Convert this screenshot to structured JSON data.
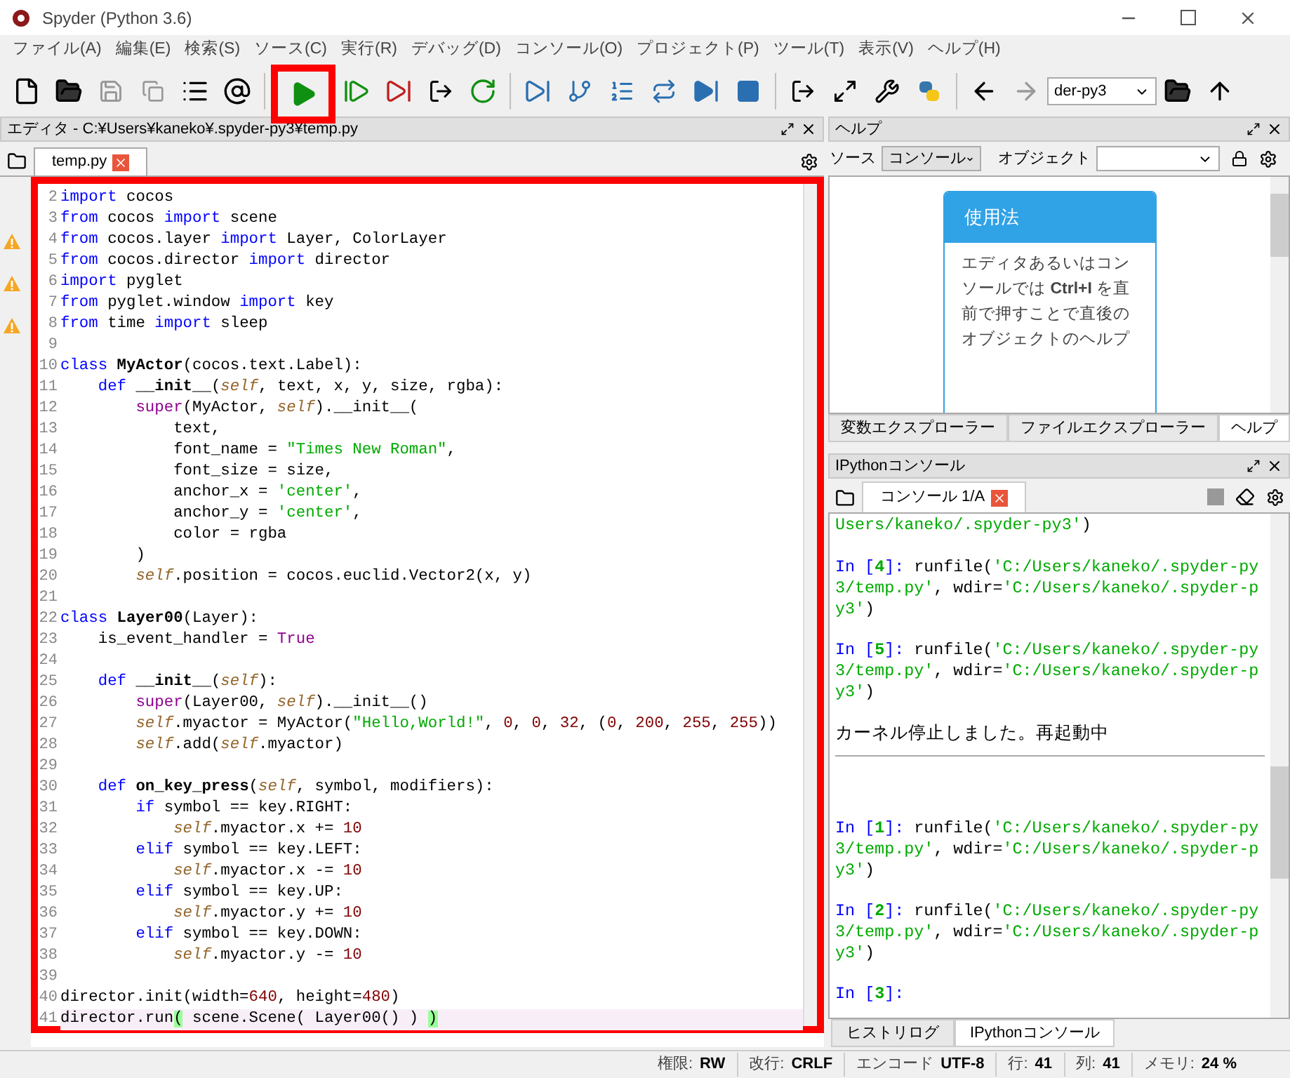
{
  "window": {
    "title": "Spyder (Python 3.6)"
  },
  "menu": [
    "ファイル(A)",
    "編集(E)",
    "検索(S)",
    "ソース(C)",
    "実行(R)",
    "デバッグ(D)",
    "コンソール(O)",
    "プロジェクト(P)",
    "ツール(T)",
    "表示(V)",
    "ヘルプ(H)"
  ],
  "toolbar": {
    "working_directory": "der-py3"
  },
  "editor": {
    "title": "エディタ - C:¥Users¥kaneko¥.spyder-py3¥temp.py",
    "tabs": [
      {
        "label": "temp.py",
        "selected": true
      }
    ],
    "lines": [
      {
        "number": "2",
        "warning": false,
        "current": false,
        "tokens": [
          {
            "kind": "kw",
            "text": "import"
          },
          {
            "kind": "plain",
            "text": " cocos"
          }
        ]
      },
      {
        "number": "3",
        "warning": false,
        "current": false,
        "tokens": [
          {
            "kind": "kw",
            "text": "from"
          },
          {
            "kind": "plain",
            "text": " cocos "
          },
          {
            "kind": "kw",
            "text": "import"
          },
          {
            "kind": "plain",
            "text": " scene"
          }
        ]
      },
      {
        "number": "4",
        "warning": true,
        "current": false,
        "tokens": [
          {
            "kind": "kw",
            "text": "from"
          },
          {
            "kind": "plain",
            "text": " cocos.layer "
          },
          {
            "kind": "kw",
            "text": "import"
          },
          {
            "kind": "plain",
            "text": " Layer, ColorLayer"
          }
        ]
      },
      {
        "number": "5",
        "warning": false,
        "current": false,
        "tokens": [
          {
            "kind": "kw",
            "text": "from"
          },
          {
            "kind": "plain",
            "text": " cocos.director "
          },
          {
            "kind": "kw",
            "text": "import"
          },
          {
            "kind": "plain",
            "text": " director"
          }
        ]
      },
      {
        "number": "6",
        "warning": true,
        "current": false,
        "tokens": [
          {
            "kind": "kw",
            "text": "import"
          },
          {
            "kind": "plain",
            "text": " pyglet"
          }
        ]
      },
      {
        "number": "7",
        "warning": false,
        "current": false,
        "tokens": [
          {
            "kind": "kw",
            "text": "from"
          },
          {
            "kind": "plain",
            "text": " pyglet.window "
          },
          {
            "kind": "kw",
            "text": "import"
          },
          {
            "kind": "plain",
            "text": " key"
          }
        ]
      },
      {
        "number": "8",
        "warning": true,
        "current": false,
        "tokens": [
          {
            "kind": "kw",
            "text": "from"
          },
          {
            "kind": "plain",
            "text": " time "
          },
          {
            "kind": "kw",
            "text": "import"
          },
          {
            "kind": "plain",
            "text": " sleep"
          }
        ]
      },
      {
        "number": "9",
        "warning": false,
        "current": false
      },
      {
        "number": "10",
        "warning": false,
        "current": false,
        "tokens": [
          {
            "kind": "kw",
            "text": "class "
          },
          {
            "kind": "def",
            "text": "MyActor"
          },
          {
            "kind": "plain",
            "text": "(cocos.text.Label):"
          }
        ]
      },
      {
        "number": "11",
        "warning": false,
        "current": false,
        "tokens": [
          {
            "kind": "kw",
            "text": "    def "
          },
          {
            "kind": "def",
            "text": "__init__"
          },
          {
            "kind": "plain",
            "text": "("
          },
          {
            "kind": "self",
            "text": "self"
          },
          {
            "kind": "plain",
            "text": ", text, x, y, size, rgba):"
          }
        ]
      },
      {
        "number": "12",
        "warning": false,
        "current": false,
        "tokens": [
          {
            "kind": "builtin",
            "text": "        super"
          },
          {
            "kind": "plain",
            "text": "(MyActor, "
          },
          {
            "kind": "self",
            "text": "self"
          },
          {
            "kind": "plain",
            "text": ").__init__("
          }
        ]
      },
      {
        "number": "13",
        "warning": false,
        "current": false,
        "tokens": [
          {
            "kind": "plain",
            "text": "            text,"
          }
        ]
      },
      {
        "number": "14",
        "warning": false,
        "current": false,
        "tokens": [
          {
            "kind": "plain",
            "text": "            font_name = "
          },
          {
            "kind": "str",
            "text": "\"Times New Roman\""
          },
          {
            "kind": "plain",
            "text": ","
          }
        ]
      },
      {
        "number": "15",
        "warning": false,
        "current": false,
        "tokens": [
          {
            "kind": "plain",
            "text": "            font_size = size,"
          }
        ]
      },
      {
        "number": "16",
        "warning": false,
        "current": false,
        "tokens": [
          {
            "kind": "plain",
            "text": "            anchor_x = "
          },
          {
            "kind": "str",
            "text": "'center'"
          },
          {
            "kind": "plain",
            "text": ","
          }
        ]
      },
      {
        "number": "17",
        "warning": false,
        "current": false,
        "tokens": [
          {
            "kind": "plain",
            "text": "            anchor_y = "
          },
          {
            "kind": "str",
            "text": "'center'"
          },
          {
            "kind": "plain",
            "text": ","
          }
        ]
      },
      {
        "number": "18",
        "warning": false,
        "current": false,
        "tokens": [
          {
            "kind": "plain",
            "text": "            color = rgba"
          }
        ]
      },
      {
        "number": "19",
        "warning": false,
        "current": false,
        "tokens": [
          {
            "kind": "plain",
            "text": "        )"
          }
        ]
      },
      {
        "number": "20",
        "warning": false,
        "current": false,
        "tokens": [
          {
            "kind": "self",
            "text": "        self"
          },
          {
            "kind": "plain",
            "text": ".position = cocos.euclid.Vector2(x, y)"
          }
        ]
      },
      {
        "number": "21",
        "warning": false,
        "current": false
      },
      {
        "number": "22",
        "warning": false,
        "current": false,
        "tokens": [
          {
            "kind": "kw",
            "text": "class "
          },
          {
            "kind": "def",
            "text": "Layer00"
          },
          {
            "kind": "plain",
            "text": "(Layer):"
          }
        ]
      },
      {
        "number": "23",
        "warning": false,
        "current": false,
        "tokens": [
          {
            "kind": "plain",
            "text": "    is_event_handler = "
          },
          {
            "kind": "builtin",
            "text": "True"
          }
        ]
      },
      {
        "number": "24",
        "warning": false,
        "current": false
      },
      {
        "number": "25",
        "warning": false,
        "current": false,
        "tokens": [
          {
            "kind": "kw",
            "text": "    def "
          },
          {
            "kind": "def",
            "text": "__init__"
          },
          {
            "kind": "plain",
            "text": "("
          },
          {
            "kind": "self",
            "text": "self"
          },
          {
            "kind": "plain",
            "text": "):"
          }
        ]
      },
      {
        "number": "26",
        "warning": false,
        "current": false,
        "tokens": [
          {
            "kind": "builtin",
            "text": "        super"
          },
          {
            "kind": "plain",
            "text": "(Layer00, "
          },
          {
            "kind": "self",
            "text": "self"
          },
          {
            "kind": "plain",
            "text": ").__init__()"
          }
        ]
      },
      {
        "number": "27",
        "warning": false,
        "current": false,
        "tokens": [
          {
            "kind": "self",
            "text": "        self"
          },
          {
            "kind": "plain",
            "text": ".myactor = MyActor("
          },
          {
            "kind": "str",
            "text": "\"Hello,World!\""
          },
          {
            "kind": "plain",
            "text": ", "
          },
          {
            "kind": "num",
            "text": "0"
          },
          {
            "kind": "plain",
            "text": ", "
          },
          {
            "kind": "num",
            "text": "0"
          },
          {
            "kind": "plain",
            "text": ", "
          },
          {
            "kind": "num",
            "text": "32"
          },
          {
            "kind": "plain",
            "text": ", ("
          },
          {
            "kind": "num",
            "text": "0"
          },
          {
            "kind": "plain",
            "text": ", "
          },
          {
            "kind": "num",
            "text": "200"
          },
          {
            "kind": "plain",
            "text": ", "
          },
          {
            "kind": "num",
            "text": "255"
          },
          {
            "kind": "plain",
            "text": ", "
          },
          {
            "kind": "num",
            "text": "255"
          },
          {
            "kind": "plain",
            "text": "))"
          }
        ]
      },
      {
        "number": "28",
        "warning": false,
        "current": false,
        "tokens": [
          {
            "kind": "self",
            "text": "        self"
          },
          {
            "kind": "plain",
            "text": ".add("
          },
          {
            "kind": "self",
            "text": "self"
          },
          {
            "kind": "plain",
            "text": ".myactor)"
          }
        ]
      },
      {
        "number": "29",
        "warning": false,
        "current": false
      },
      {
        "number": "30",
        "warning": false,
        "current": false,
        "tokens": [
          {
            "kind": "kw",
            "text": "    def "
          },
          {
            "kind": "def",
            "text": "on_key_press"
          },
          {
            "kind": "plain",
            "text": "("
          },
          {
            "kind": "self",
            "text": "self"
          },
          {
            "kind": "plain",
            "text": ", symbol, modifiers):"
          }
        ]
      },
      {
        "number": "31",
        "warning": false,
        "current": false,
        "tokens": [
          {
            "kind": "kw",
            "text": "        if"
          },
          {
            "kind": "plain",
            "text": " symbol == key.RIGHT:"
          }
        ]
      },
      {
        "number": "32",
        "warning": false,
        "current": false,
        "tokens": [
          {
            "kind": "self",
            "text": "            self"
          },
          {
            "kind": "plain",
            "text": ".myactor.x += "
          },
          {
            "kind": "num",
            "text": "10"
          }
        ]
      },
      {
        "number": "33",
        "warning": false,
        "current": false,
        "tokens": [
          {
            "kind": "kw",
            "text": "        elif"
          },
          {
            "kind": "plain",
            "text": " symbol == key.LEFT:"
          }
        ]
      },
      {
        "number": "34",
        "warning": false,
        "current": false,
        "tokens": [
          {
            "kind": "self",
            "text": "            self"
          },
          {
            "kind": "plain",
            "text": ".myactor.x -= "
          },
          {
            "kind": "num",
            "text": "10"
          }
        ]
      },
      {
        "number": "35",
        "warning": false,
        "current": false,
        "tokens": [
          {
            "kind": "kw",
            "text": "        elif"
          },
          {
            "kind": "plain",
            "text": " symbol == key.UP:"
          }
        ]
      },
      {
        "number": "36",
        "warning": false,
        "current": false,
        "tokens": [
          {
            "kind": "self",
            "text": "            self"
          },
          {
            "kind": "plain",
            "text": ".myactor.y += "
          },
          {
            "kind": "num",
            "text": "10"
          }
        ]
      },
      {
        "number": "37",
        "warning": false,
        "current": false,
        "tokens": [
          {
            "kind": "kw",
            "text": "        elif"
          },
          {
            "kind": "plain",
            "text": " symbol == key.DOWN:"
          }
        ]
      },
      {
        "number": "38",
        "warning": false,
        "current": false,
        "tokens": [
          {
            "kind": "self",
            "text": "            self"
          },
          {
            "kind": "plain",
            "text": ".myactor.y -= "
          },
          {
            "kind": "num",
            "text": "10"
          }
        ]
      },
      {
        "number": "39",
        "warning": false,
        "current": false
      },
      {
        "number": "40",
        "warning": false,
        "current": false,
        "tokens": [
          {
            "kind": "plain",
            "text": "director.init(width="
          },
          {
            "kind": "num",
            "text": "640"
          },
          {
            "kind": "plain",
            "text": ", height="
          },
          {
            "kind": "num",
            "text": "480"
          },
          {
            "kind": "plain",
            "text": ")"
          }
        ]
      },
      {
        "number": "41",
        "warning": false,
        "current": true,
        "tokens": [
          {
            "kind": "plain",
            "text": "director.run"
          },
          {
            "kind": "bracket",
            "text": "("
          },
          {
            "kind": "plain",
            "text": " scene.Scene( Layer00() ) "
          },
          {
            "kind": "bracket",
            "text": ")"
          }
        ]
      }
    ]
  },
  "help": {
    "title": "ヘルプ",
    "source_label": "ソース",
    "source_value": "コンソール",
    "object_label": "オブジェクト",
    "card_title": "使用法",
    "card_text": "エディタあるいはコンソールでは **Ctrl+I** を直前で押すことで直後のオブジェクトのヘルプ",
    "tabs": [
      {
        "label": "変数エクスプローラー",
        "selected": false
      },
      {
        "label": "ファイルエクスプローラー",
        "selected": false
      },
      {
        "label": "ヘルプ",
        "selected": true
      }
    ]
  },
  "console": {
    "title": "IPythonコンソール",
    "tabs": [
      {
        "label": "コンソール 1/A",
        "selected": true
      }
    ],
    "entries": [
      {
        "kind": "output",
        "tokens": [
          {
            "kind": "str",
            "text": "Users/kaneko/.spyder-py3'"
          },
          {
            "kind": "plain",
            "text": ")"
          }
        ]
      },
      {
        "kind": "input",
        "prompt": "In [",
        "number": "4",
        "prompt_end": "]:",
        "tokens": [
          {
            "kind": "plain",
            "text": " runfile("
          },
          {
            "kind": "str",
            "text": "'C:/Users/kaneko/.spyder-py3/temp.py'"
          },
          {
            "kind": "plain",
            "text": ", wdir="
          },
          {
            "kind": "str",
            "text": "'C:/Users/kaneko/.spyder-py3'"
          },
          {
            "kind": "plain",
            "text": ")"
          }
        ]
      },
      {
        "kind": "input",
        "prompt": "In [",
        "number": "5",
        "prompt_end": "]:",
        "tokens": [
          {
            "kind": "plain",
            "text": " runfile("
          },
          {
            "kind": "str",
            "text": "'C:/Users/kaneko/.spyder-py3/temp.py'"
          },
          {
            "kind": "plain",
            "text": ", wdir="
          },
          {
            "kind": "str",
            "text": "'C:/Users/kaneko/.spyder-py3'"
          },
          {
            "kind": "plain",
            "text": ")"
          }
        ]
      },
      {
        "kind": "message",
        "text": "カーネル停止しました。再起動中"
      },
      {
        "kind": "separator"
      },
      {
        "kind": "input",
        "prompt": "In [",
        "number": "1",
        "prompt_end": "]:",
        "tokens": [
          {
            "kind": "plain",
            "text": " runfile("
          },
          {
            "kind": "str",
            "text": "'C:/Users/kaneko/.spyder-py3/temp.py'"
          },
          {
            "kind": "plain",
            "text": ", wdir="
          },
          {
            "kind": "str",
            "text": "'C:/Users/kaneko/.spyder-py3'"
          },
          {
            "kind": "plain",
            "text": ")"
          }
        ]
      },
      {
        "kind": "input",
        "prompt": "In [",
        "number": "2",
        "prompt_end": "]:",
        "tokens": [
          {
            "kind": "plain",
            "text": " runfile("
          },
          {
            "kind": "str",
            "text": "'C:/Users/kaneko/.spyder-py3/temp.py'"
          },
          {
            "kind": "plain",
            "text": ", wdir="
          },
          {
            "kind": "str",
            "text": "'C:/Users/kaneko/.spyder-py3'"
          },
          {
            "kind": "plain",
            "text": ")"
          }
        ]
      },
      {
        "kind": "input",
        "prompt": "In [",
        "number": "3",
        "prompt_end": "]:"
      }
    ],
    "bottom_tabs": [
      {
        "label": "ヒストリログ",
        "selected": false
      },
      {
        "label": "IPythonコンソール",
        "selected": true
      }
    ]
  },
  "status_bar": [
    {
      "label": "権限:",
      "value": "RW"
    },
    {
      "label": "改行:",
      "value": "CRLF"
    },
    {
      "label": "エンコード",
      "value": "UTF-8"
    },
    {
      "label": "行:",
      "value": "41"
    },
    {
      "label": "列:",
      "value": "41"
    },
    {
      "label": "メモリ:",
      "value": "24 %"
    }
  ]
}
